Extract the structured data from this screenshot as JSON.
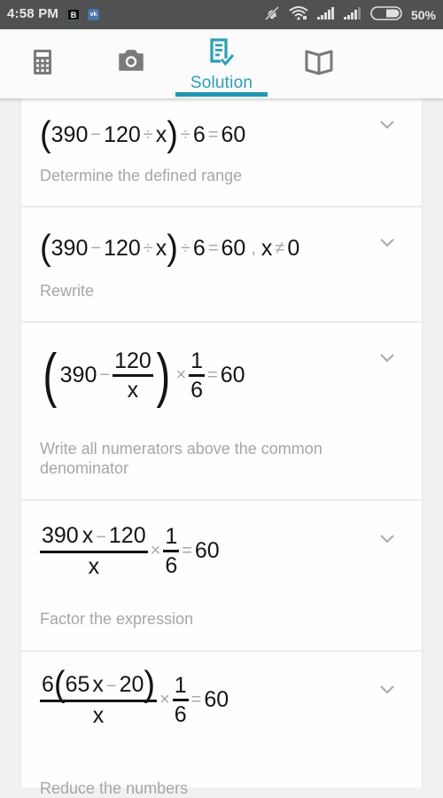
{
  "status_bar": {
    "time": "4:58 PM",
    "notifications": [
      "B",
      "vk"
    ],
    "battery_percent": "50%",
    "icons": [
      "silent-icon",
      "wifi-icon",
      "signal-icon",
      "signal-icon-2",
      "battery-icon"
    ]
  },
  "tabs": [
    {
      "id": "calculator",
      "icon": "calculator-icon",
      "label": "",
      "active": false
    },
    {
      "id": "camera",
      "icon": "camera-icon",
      "label": "",
      "active": false
    },
    {
      "id": "solution",
      "icon": "solution-icon",
      "label": "Solution",
      "active": true
    },
    {
      "id": "book",
      "icon": "book-icon",
      "label": "",
      "active": false
    }
  ],
  "colors": {
    "accent": "#1f97b3",
    "status_bar": "#4f5153",
    "description_text": "#a6a6a6"
  },
  "steps": [
    {
      "expr": {
        "a": "390",
        "minus": "−",
        "b": "120",
        "div": "÷",
        "x": "x",
        "div2": "÷",
        "c": "6",
        "eq": "=",
        "rhs": "60"
      },
      "description": "Determine the defined range"
    },
    {
      "expr": {
        "a": "390",
        "minus": "−",
        "b": "120",
        "div": "÷",
        "x": "x",
        "div2": "÷",
        "c": "6",
        "eq": "=",
        "rhs": "60",
        "comma": ",",
        "cond_var": "x",
        "neq": "≠",
        "cond_val": "0"
      },
      "description": "Rewrite"
    },
    {
      "expr": {
        "a": "390",
        "minus": "−",
        "num": "120",
        "den": "x",
        "times": "×",
        "num2": "1",
        "den2": "6",
        "eq": "=",
        "rhs": "60"
      },
      "description": "Write all numerators above the common denominator"
    },
    {
      "expr": {
        "num_a": "390",
        "num_x": "x",
        "minus": "−",
        "num_b": "120",
        "den": "x",
        "times": "×",
        "num2": "1",
        "den2": "6",
        "eq": "=",
        "rhs": "60"
      },
      "description": "Factor the expression"
    },
    {
      "expr": {
        "factor": "6",
        "inner_a": "65",
        "inner_x": "x",
        "minus": "−",
        "inner_b": "20",
        "den": "x",
        "times": "×",
        "num2": "1",
        "den2": "6",
        "eq": "=",
        "rhs": "60"
      },
      "description": "Reduce the numbers"
    }
  ]
}
